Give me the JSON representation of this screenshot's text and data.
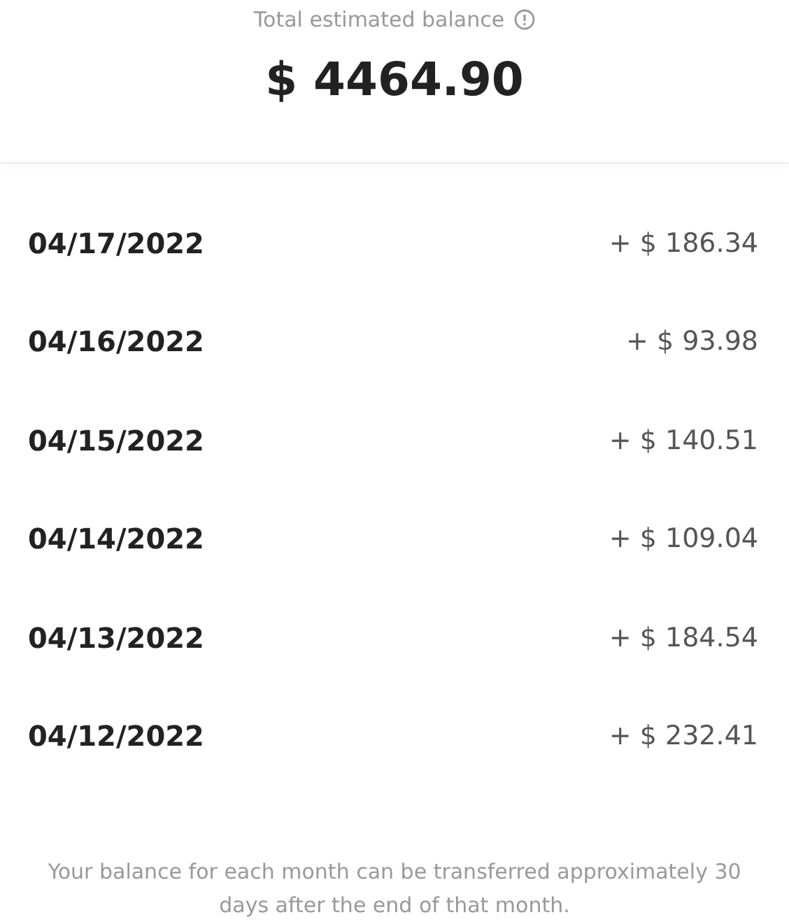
{
  "balance": {
    "label": "Total estimated balance",
    "amount": "$ 4464.90"
  },
  "entries": [
    {
      "date": "04/17/2022",
      "amount": "+ $ 186.34"
    },
    {
      "date": "04/16/2022",
      "amount": "+ $ 93.98"
    },
    {
      "date": "04/15/2022",
      "amount": "+ $ 140.51"
    },
    {
      "date": "04/14/2022",
      "amount": "+ $ 109.04"
    },
    {
      "date": "04/13/2022",
      "amount": "+ $ 184.54"
    },
    {
      "date": "04/12/2022",
      "amount": "+ $ 232.41"
    }
  ],
  "footer": "Your balance for each month can be transferred approximately 30 days after the end of that month."
}
